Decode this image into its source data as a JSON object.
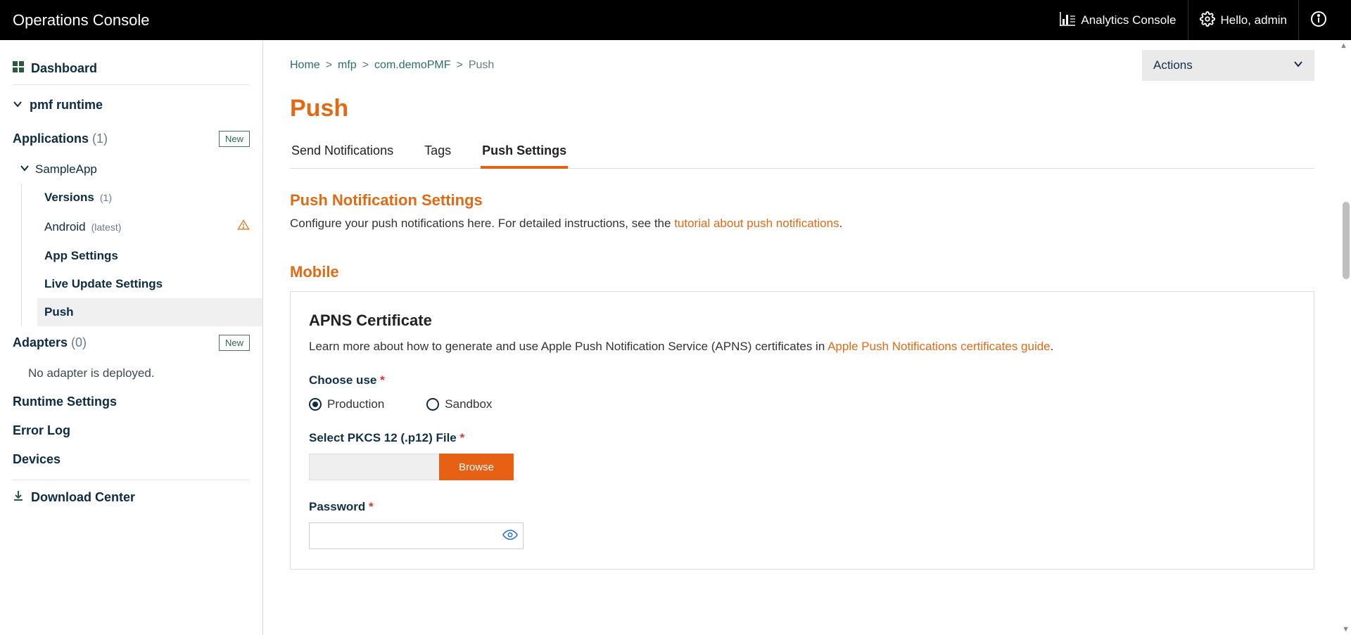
{
  "header": {
    "title": "Operations Console",
    "analytics_label": "Analytics Console",
    "greeting": "Hello, admin"
  },
  "sidebar": {
    "dashboard": "Dashboard",
    "runtime": "pmf runtime",
    "applications": {
      "label": "Applications",
      "count": "(1)",
      "new": "New"
    },
    "sampleapp": {
      "label": "SampleApp",
      "versions": {
        "label": "Versions",
        "count": "(1)"
      },
      "android": {
        "label": "Android",
        "sub": "(latest)"
      },
      "app_settings": "App Settings",
      "live_update": "Live Update Settings",
      "push": "Push"
    },
    "adapters": {
      "label": "Adapters",
      "count": "(0)",
      "new": "New",
      "empty": "No adapter is deployed."
    },
    "runtime_settings": "Runtime Settings",
    "error_log": "Error Log",
    "devices": "Devices",
    "download_center": "Download Center"
  },
  "breadcrumb": {
    "home": "Home",
    "mfp": "mfp",
    "app": "com.demoPMF",
    "current": "Push"
  },
  "actions": {
    "label": "Actions"
  },
  "page": {
    "title": "Push",
    "tabs": {
      "send": "Send Notifications",
      "tags": "Tags",
      "settings": "Push Settings"
    },
    "settings_heading": "Push Notification Settings",
    "settings_text_1": "Configure your push notifications here. For detailed instructions, see the ",
    "settings_link": "tutorial about push notifications",
    "settings_text_2": ".",
    "mobile_heading": "Mobile",
    "apns": {
      "title": "APNS Certificate",
      "desc_1": "Learn more about how to generate and use Apple Push Notification Service (APNS) certificates in ",
      "desc_link": "Apple Push Notifications certificates guide",
      "desc_2": ".",
      "choose_use": "Choose use",
      "production": "Production",
      "sandbox": "Sandbox",
      "select_file": "Select PKCS 12 (.p12) File",
      "browse": "Browse",
      "password": "Password"
    }
  }
}
